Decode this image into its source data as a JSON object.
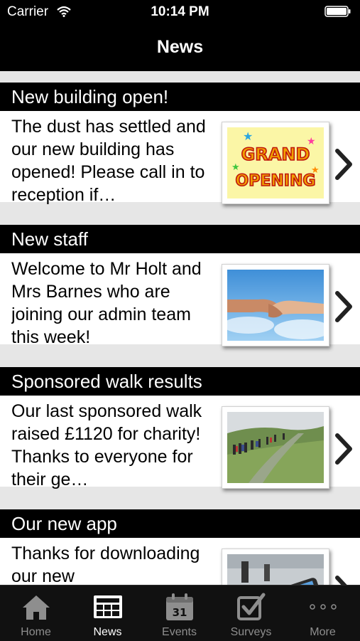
{
  "status_bar": {
    "carrier": "Carrier",
    "time": "10:14 PM",
    "wifi_icon": "wifi-icon",
    "battery_icon": "battery-icon"
  },
  "nav_bar": {
    "title": "News"
  },
  "news": [
    {
      "title": "New building open!",
      "summary": "The dust has settled and our new building has opened! Please call in to reception if…",
      "image": "grand-opening-image",
      "image_text_1": "GRAND",
      "image_text_2": "OPENING"
    },
    {
      "title": "New staff",
      "summary": "Welcome to Mr Holt and Mrs Barnes who are joining our admin team this week!",
      "image": "handshake-image"
    },
    {
      "title": "Sponsored walk results",
      "summary": "Our last sponsored walk raised £1120 for charity! Thanks to everyone for their ge…",
      "image": "walkers-image"
    },
    {
      "title": "Our new app",
      "summary": "Thanks for downloading our new",
      "image": "phone-image"
    }
  ],
  "tabs": [
    {
      "label": "Home",
      "icon": "home-icon",
      "active": false
    },
    {
      "label": "News",
      "icon": "news-icon",
      "active": true
    },
    {
      "label": "Events",
      "icon": "calendar-icon",
      "active": false,
      "icon_text": "31"
    },
    {
      "label": "Surveys",
      "icon": "checkbox-icon",
      "active": false
    },
    {
      "label": "More",
      "icon": "more-icon",
      "active": false
    }
  ],
  "colors": {
    "bar_background": "#000000",
    "feed_background": "#e6e6e6",
    "tab_active": "#ffffff",
    "tab_inactive": "#8e8e8e"
  }
}
